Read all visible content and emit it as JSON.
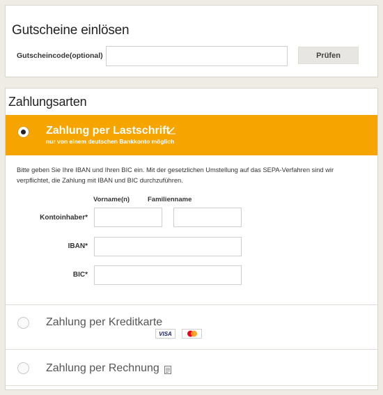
{
  "voucher": {
    "title": "Gutscheine einlösen",
    "code_label": "Gutscheincode(optional)",
    "code_value": "",
    "check_button": "Prüfen"
  },
  "payment": {
    "title": "Zahlungsarten",
    "options": [
      {
        "label": "Zahlung per Lastschrift",
        "sublabel": "nur von einem deutschen Bankkonto möglich",
        "selected": true,
        "icon": "pencil-icon"
      },
      {
        "label": "Zahlung per Kreditkarte",
        "selected": false,
        "cards": [
          "VISA",
          "mastercard"
        ]
      },
      {
        "label": "Zahlung per Rechnung",
        "selected": false,
        "icon": "invoice-icon"
      }
    ],
    "debit_form": {
      "info": "Bitte geben Sie Ihre IBAN und Ihren BIC ein. Mit der gesetzlichen Umstellung auf das SEPA-Verfahren sind wir verpflichtet, die Zahlung mit IBAN und BIC durchzuführen.",
      "col_first_name": "Vorname(n)",
      "col_last_name": "Familienname",
      "account_holder_label": "Kontoinhaber*",
      "iban_label": "IBAN*",
      "bic_label": "BIC*",
      "first_name_value": "",
      "last_name_value": "",
      "iban_value": "",
      "bic_value": ""
    }
  },
  "colors": {
    "accent_orange": "#f6a500",
    "background": "#efece6",
    "panel": "#ffffff",
    "visa_blue": "#1a1f71",
    "mastercard_red": "#eb001b",
    "mastercard_yellow": "#f79e1b"
  }
}
